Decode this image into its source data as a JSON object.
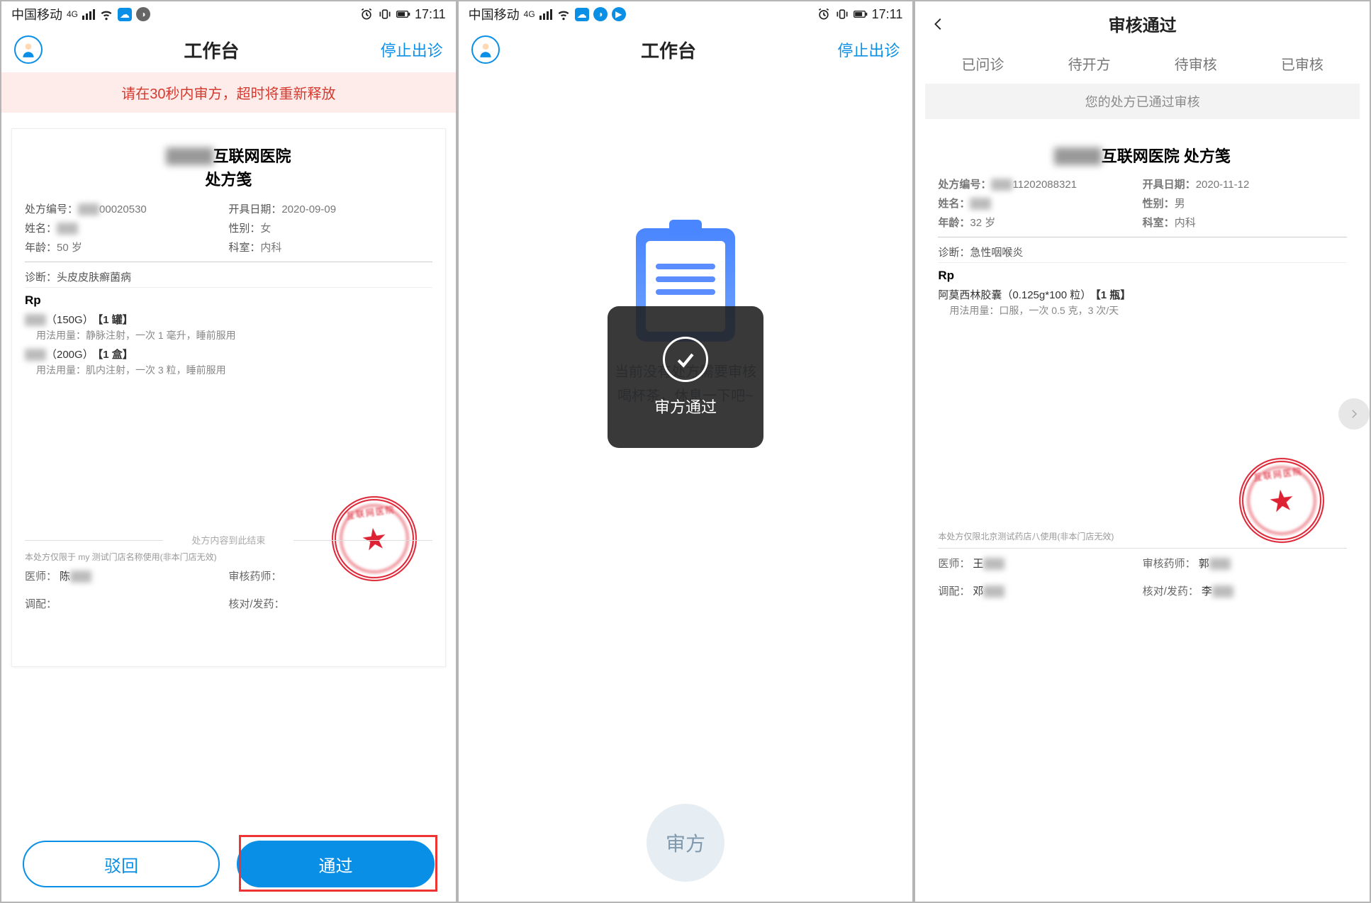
{
  "status": {
    "carrier": "中国移动",
    "time": "17:11",
    "net": "4G"
  },
  "s1": {
    "header": {
      "title": "工作台",
      "stop": "停止出诊"
    },
    "warning": "请在30秒内审方，超时将重新释放",
    "hospital_line1_suffix": "互联网医院",
    "hospital_line2": "处方笺",
    "meta": {
      "rx_no_label": "处方编号：",
      "rx_no_suffix": "00020530",
      "issue_label": "开具日期：",
      "issue": "2020-09-09",
      "name_label": "姓名：",
      "sex_label": "性别：",
      "sex": "女",
      "age_label": "年龄：",
      "age": "50 岁",
      "dept_label": "科室：",
      "dept": "内科"
    },
    "diag_label": "诊断：",
    "diag": "头皮皮肤癣菌病",
    "rp": "Rp",
    "drug1": {
      "spec": "（150G）",
      "qty": "【1 罐】",
      "dosage_label": "用法用量：",
      "dosage": "静脉注射，一次 1 毫升，睡前服用"
    },
    "drug2": {
      "spec": "（200G）",
      "qty": "【1 盒】",
      "dosage_label": "用法用量：",
      "dosage": "肌内注射，一次 3 粒，睡前服用"
    },
    "endline": "处方内容到此结束",
    "note": "本处方仅限于 my 测试门店名称使用(非本门店无效)",
    "sign": {
      "doctor": "医师：",
      "doctor_v": "陈",
      "reviewer": "审核药师：",
      "dispense": "调配：",
      "check": "核对/发药："
    },
    "btn_reject": "驳回",
    "btn_approve": "通过"
  },
  "s2": {
    "header": {
      "title": "工作台",
      "stop": "停止出诊"
    },
    "empty_l1": "当前没有处方需要审核",
    "empty_l2": "喝杯茶，休息一下吧~",
    "toast": "审方通过",
    "fab": "审方"
  },
  "s3": {
    "title": "审核通过",
    "tabs": [
      "已问诊",
      "待开方",
      "待审核",
      "已审核"
    ],
    "banner": "您的处方已通过审核",
    "hospital_line1_suffix": "互联网医院  处方笺",
    "meta": {
      "rx_no_label": "处方编号：",
      "rx_no": "11202088321",
      "issue_label": "开具日期：",
      "issue": "2020-11-12",
      "name_label": "姓名：",
      "sex_label": "性别：",
      "sex": "男",
      "age_label": "年龄：",
      "age": "32 岁",
      "dept_label": "科室：",
      "dept": "内科"
    },
    "diag_label": "诊断：",
    "diag": "急性咽喉炎",
    "rp": "Rp",
    "drug": {
      "name": "阿莫西林胶囊",
      "spec": "（0.125g*100 粒）",
      "qty": "【1 瓶】",
      "dosage_label": "用法用量：",
      "dosage": "口服，一次 0.5 克，3 次/天"
    },
    "note": "本处方仅限北京测试药店八使用(非本门店无效)",
    "sign": {
      "doctor": "医师：",
      "doctor_v": "王",
      "reviewer": "审核药师：",
      "reviewer_v": "郭",
      "dispense": "调配：",
      "dispense_v": "邓",
      "check": "核对/发药：",
      "check_v": "李"
    }
  },
  "seal_text": "互联网医院"
}
